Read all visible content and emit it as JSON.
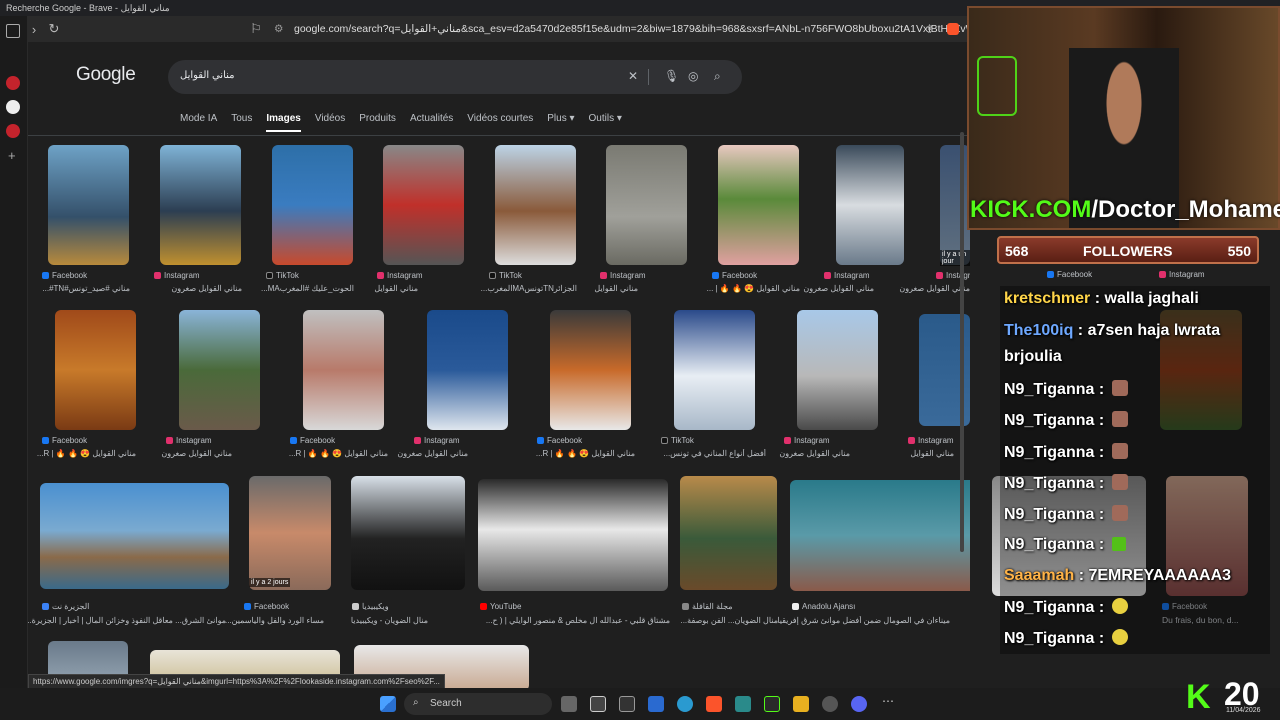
{
  "window_title": "Recherche Google - Brave - مناني القوايل",
  "url": "google.com/search?q=مناني+القوايل&sca_esv=d2a5470d2e85f15e&udm=2&biw=1879&bih=968&sxsrf=ANbL-n756FWO8bUboxu2tA1VxiBtHhZvW...",
  "status_url": "https://www.google.com/imgres?q=مناني القوايل&imgurl=https%3A%2F%2Flookaside.instagram.com%2Fseo%2F...",
  "google": {
    "logo": "Google",
    "query": "مناني القوايل",
    "tabs": [
      "Mode IA",
      "Tous",
      "Images",
      "Vidéos",
      "Produits",
      "Actualités",
      "Vidéos courtes",
      "Plus ▾",
      "Outils ▾"
    ],
    "active_tab": "Images"
  },
  "results": [
    {
      "source": "Facebook",
      "caption": "مناني #صيد_تونس#TN#...",
      "color": "#1877f2"
    },
    {
      "source": "Instagram",
      "caption": "مناني القوايل صغرون",
      "color": "#e1306c"
    },
    {
      "source": "TikTok",
      "caption": "الحوت_عليك #المغربMA...",
      "color": "#111111"
    },
    {
      "source": "Instagram",
      "caption": "مناني القوايل",
      "color": "#e1306c"
    },
    {
      "source": "TikTok",
      "caption": "الجزائرTNتونسMAالمغرب...",
      "color": "#111111"
    },
    {
      "source": "Instagram",
      "caption": "مناني القوايل",
      "color": "#e1306c"
    },
    {
      "source": "Facebook",
      "caption": "مناني القوايل 😍 🔥 🔥 | ...",
      "color": "#1877f2"
    },
    {
      "source": "Instagram",
      "caption": "مناني القوايل صغرون",
      "color": "#e1306c"
    },
    {
      "source": "Instagram",
      "caption": "مناني القوايل صغرون",
      "color": "#e1306c"
    },
    {
      "source": "Facebook",
      "caption": "مناني القوايل 😍 🔥 🔥 | R...",
      "color": "#1877f2"
    },
    {
      "source": "Instagram",
      "caption": "مناني القوايل صغرون",
      "color": "#e1306c"
    },
    {
      "source": "Facebook",
      "caption": "مناني القوايل 😍 🔥 🔥 | R...",
      "color": "#1877f2"
    },
    {
      "source": "Instagram",
      "caption": "مناني القوايل صغرون",
      "color": "#e1306c"
    },
    {
      "source": "Facebook",
      "caption": "مناني القوايل 😍 🔥 🔥 | R...",
      "color": "#1877f2"
    },
    {
      "source": "TikTok",
      "caption": "أفضل أنواع المناني في تونس...",
      "color": "#111111"
    },
    {
      "source": "Instagram",
      "caption": "مناني القوايل صغرون",
      "color": "#e1306c"
    },
    {
      "source": "Instagram",
      "caption": "مناني القوايل",
      "color": "#e1306c"
    },
    {
      "source": "الجزيرة نت",
      "caption": "موانئ الشرق... معاقل النفوذ وخزائن المال | أخبار | الجزيرة...",
      "color": "#3b82f6"
    },
    {
      "source": "Facebook",
      "caption": "مساء الورد والفل والياسمين...",
      "color": "#1877f2"
    },
    {
      "source": "ويكيبيديا",
      "caption": "منال الضويان - ويكيبيديا",
      "color": "#cccccc"
    },
    {
      "source": "YouTube",
      "caption": "مشتاق قلبي - عبدالله ال مخلص & منصور الوايلي | ( ح...",
      "color": "#ff0000"
    },
    {
      "source": "مجلة القافلة",
      "caption": "منال الضويان... الفن بوصفة...",
      "color": "#888888"
    },
    {
      "source": "Anadolu Ajansı",
      "caption": "ميناءان في الصومال ضمن أفضل موانئ شرق إفريقيا",
      "color": "#eeeeee"
    }
  ],
  "labels": {
    "il_y_a_un_jour": "il y a un jour",
    "il_y_a_2_jours": "il y a 2 jours",
    "fb_right": "Du frais, du bon, d..."
  },
  "stream": {
    "kick_url": "KICK.COM/Doctor_Mohamed",
    "kick_prefix": "KICK.COM",
    "kick_path": "/Doctor_Mohamed",
    "followers_label": "FOLLOWERS",
    "followers_left": "568",
    "followers_right": "550",
    "counter": "20",
    "date": "11/04/2026",
    "chat": [
      {
        "user": "kretschmer",
        "msg": " : walla jaghali",
        "ucolor": "#ffd54a"
      },
      {
        "user": "The100iq",
        "msg": " : a7sen haja lwrata",
        "ucolor": "#6ea8ff"
      },
      {
        "user": "",
        "msg": "brjoulia",
        "ucolor": "#ffffff"
      },
      {
        "user": "N9_Tiganna",
        "msg": " :",
        "ucolor": "#ffffff"
      },
      {
        "user": "N9_Tiganna",
        "msg": " :",
        "ucolor": "#ffffff"
      },
      {
        "user": "N9_Tiganna",
        "msg": " :",
        "ucolor": "#ffffff"
      },
      {
        "user": "N9_Tiganna",
        "msg": " :",
        "ucolor": "#ffffff"
      },
      {
        "user": "N9_Tiganna",
        "msg": " :",
        "ucolor": "#ffffff"
      },
      {
        "user": "N9_Tiganna",
        "msg": " :",
        "ucolor": "#ffffff"
      },
      {
        "user": "Saaamah",
        "msg": " : 7EMREYAAAAAA3",
        "ucolor": "#ffb347"
      },
      {
        "user": "N9_Tiganna",
        "msg": " :",
        "ucolor": "#ffffff"
      },
      {
        "user": "N9_Tiganna",
        "msg": " :",
        "ucolor": "#ffffff"
      }
    ]
  },
  "taskbar": {
    "search_label": "Search"
  }
}
